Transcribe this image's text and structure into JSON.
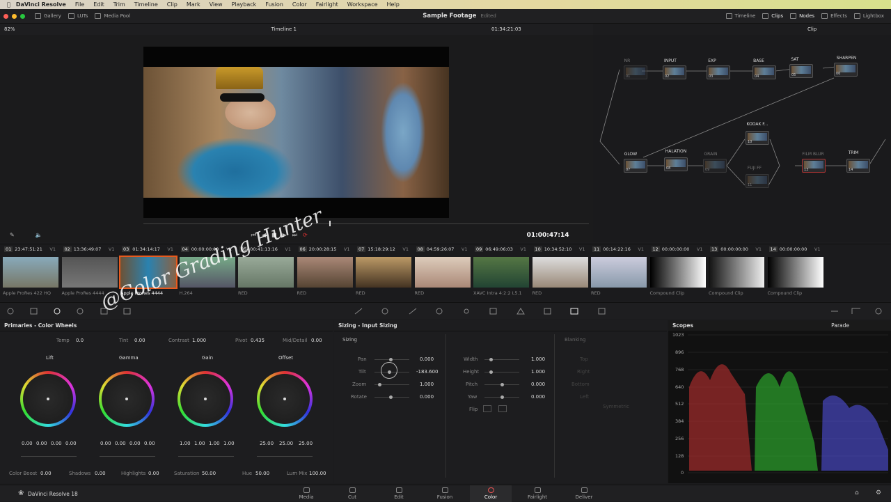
{
  "menubar": {
    "app": "DaVinci Resolve",
    "items": [
      "File",
      "Edit",
      "Trim",
      "Timeline",
      "Clip",
      "Mark",
      "View",
      "Playback",
      "Fusion",
      "Color",
      "Fairlight",
      "Workspace",
      "Help"
    ]
  },
  "topbar": {
    "left": [
      "Gallery",
      "LUTs",
      "Media Pool"
    ],
    "project": "Sample Footage",
    "status": "Edited",
    "right": [
      "Timeline",
      "Clips",
      "Nodes",
      "Effects",
      "Lightbox"
    ]
  },
  "viewer": {
    "zoom": "82%",
    "timeline": "Timeline 1",
    "timecode": "01:34:21:03",
    "current_tc": "01:00:47:14",
    "mode": "Clip"
  },
  "nodes": [
    {
      "label": "NR",
      "num": "01"
    },
    {
      "label": "INPUT",
      "num": "02"
    },
    {
      "label": "EXP",
      "num": "03"
    },
    {
      "label": "BASE",
      "num": "04"
    },
    {
      "label": "SAT",
      "num": "05"
    },
    {
      "label": "SHARPEN",
      "num": "06"
    },
    {
      "label": "GLOW",
      "num": "07"
    },
    {
      "label": "HALATION",
      "num": "08"
    },
    {
      "label": "GRAIN",
      "num": "09"
    },
    {
      "label": "KODAK F...",
      "num": "10"
    },
    {
      "label": "FUJI FF",
      "num": "11"
    },
    {
      "label": "FILM BLUR",
      "num": "13"
    },
    {
      "label": "TRIM",
      "num": "14"
    }
  ],
  "clips": [
    {
      "n": "01",
      "tc": "23:47:51:21",
      "t": "V1",
      "codec": "Apple ProRes 422 HQ"
    },
    {
      "n": "02",
      "tc": "13:36:49:07",
      "t": "V1",
      "codec": "Apple ProRes 4444"
    },
    {
      "n": "03",
      "tc": "01:34:14:17",
      "t": "V1",
      "codec": "Apple ProRes 4444"
    },
    {
      "n": "04",
      "tc": "00:00:00:00",
      "t": "V1",
      "codec": "H.264"
    },
    {
      "n": "05",
      "tc": "00:41:13:16",
      "t": "V1",
      "codec": "RED"
    },
    {
      "n": "06",
      "tc": "20:00:28:15",
      "t": "V1",
      "codec": "RED"
    },
    {
      "n": "07",
      "tc": "15:18:29:12",
      "t": "V1",
      "codec": "RED"
    },
    {
      "n": "08",
      "tc": "04:59:26:07",
      "t": "V1",
      "codec": "RED"
    },
    {
      "n": "09",
      "tc": "06:49:06:03",
      "t": "V1",
      "codec": "XAVC Intra 4:2:2 L5.1"
    },
    {
      "n": "10",
      "tc": "10:34:52:10",
      "t": "V1",
      "codec": "RED"
    },
    {
      "n": "11",
      "tc": "00:14:22:16",
      "t": "V1",
      "codec": "RED"
    },
    {
      "n": "12",
      "tc": "00:00:00:00",
      "t": "V1",
      "codec": "Compound Clip"
    },
    {
      "n": "13",
      "tc": "00:00:00:00",
      "t": "V1",
      "codec": "Compound Clip"
    },
    {
      "n": "14",
      "tc": "00:00:00:00",
      "t": "V1",
      "codec": "Compound Clip"
    }
  ],
  "primaries": {
    "title": "Primaries - Color Wheels",
    "temp_label": "Temp",
    "temp": "0.0",
    "tint_label": "Tint",
    "tint": "0.00",
    "contrast_label": "Contrast",
    "contrast": "1.000",
    "pivot_label": "Pivot",
    "pivot": "0.435",
    "md_label": "Mid/Detail",
    "md": "0.00",
    "wheels": [
      {
        "name": "Lift",
        "vals": [
          "0.00",
          "0.00",
          "0.00",
          "0.00"
        ]
      },
      {
        "name": "Gamma",
        "vals": [
          "0.00",
          "0.00",
          "0.00",
          "0.00"
        ]
      },
      {
        "name": "Gain",
        "vals": [
          "1.00",
          "1.00",
          "1.00",
          "1.00"
        ]
      },
      {
        "name": "Offset",
        "vals": [
          "25.00",
          "25.00",
          "25.00"
        ]
      }
    ],
    "bottom": [
      {
        "l": "Color Boost",
        "v": "0.00"
      },
      {
        "l": "Shadows",
        "v": "0.00"
      },
      {
        "l": "Highlights",
        "v": "0.00"
      },
      {
        "l": "Saturation",
        "v": "50.00"
      },
      {
        "l": "Hue",
        "v": "50.00"
      },
      {
        "l": "Lum Mix",
        "v": "100.00"
      }
    ]
  },
  "sizing": {
    "title": "Sizing - Input Sizing",
    "section": "Sizing",
    "blanking": "Blanking",
    "left": [
      {
        "l": "Pan",
        "v": "0.000"
      },
      {
        "l": "Tilt",
        "v": "-183.600"
      },
      {
        "l": "Zoom",
        "v": "1.000"
      },
      {
        "l": "Rotate",
        "v": "0.000"
      }
    ],
    "right": [
      {
        "l": "Width",
        "v": "1.000"
      },
      {
        "l": "Height",
        "v": "1.000"
      },
      {
        "l": "Pitch",
        "v": "0.000"
      },
      {
        "l": "Yaw",
        "v": "0.000"
      }
    ],
    "flip": "Flip",
    "blank_items": [
      "Top",
      "Right",
      "Bottom",
      "Left"
    ],
    "symmetric": "Symmetric"
  },
  "scopes": {
    "title": "Scopes",
    "mode": "Parade",
    "ticks": [
      "1023",
      "896",
      "768",
      "640",
      "512",
      "384",
      "256",
      "128",
      "0"
    ]
  },
  "pages": [
    "Media",
    "Cut",
    "Edit",
    "Fusion",
    "Color",
    "Fairlight",
    "Deliver"
  ],
  "active_page": "Color",
  "footer": {
    "app": "DaVinci Resolve 18"
  },
  "watermark": "@Color Grading Hunter"
}
